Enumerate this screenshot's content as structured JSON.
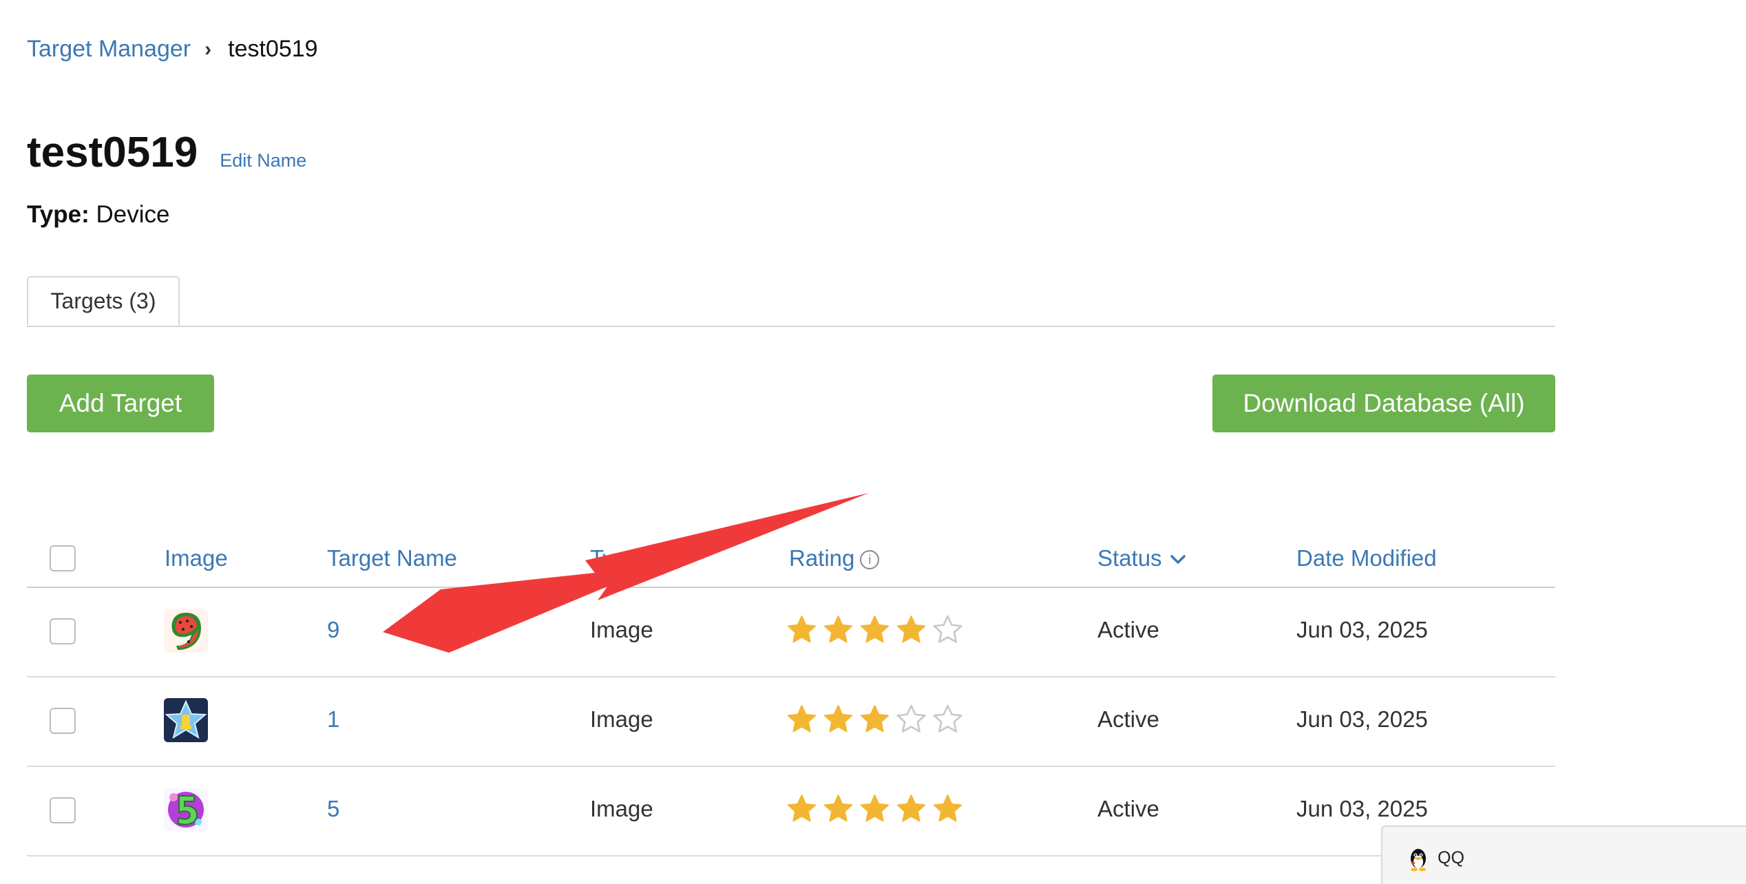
{
  "breadcrumb": {
    "parent": "Target Manager",
    "separator": "›",
    "current": "test0519"
  },
  "header": {
    "title": "test0519",
    "edit_label": "Edit Name",
    "type_label": "Type:",
    "type_value": "Device"
  },
  "tabs": [
    {
      "label": "Targets (3)",
      "active": true
    }
  ],
  "actions": {
    "add_target": "Add Target",
    "download_database": "Download Database (All)"
  },
  "colors": {
    "link": "#3a78b5",
    "button": "#6cb24f",
    "star_filled": "#f3b632",
    "star_empty": "#c8c8c8",
    "arrow": "#f03a3a"
  },
  "table": {
    "columns": {
      "image": "Image",
      "target_name": "Target Name",
      "type": "Type",
      "rating": "Rating",
      "status": "Status",
      "date_modified": "Date Modified"
    },
    "rating_info_icon": "info-icon",
    "status_sort_icon": "chevron-down-icon",
    "rows": [
      {
        "thumbnail": "watermelon-nine-thumbnail",
        "name": "9",
        "type": "Image",
        "rating": 4,
        "rating_max": 5,
        "status": "Active",
        "date_modified": "Jun 03, 2025"
      },
      {
        "thumbnail": "star-one-thumbnail",
        "name": "1",
        "type": "Image",
        "rating": 3,
        "rating_max": 5,
        "status": "Active",
        "date_modified": "Jun 03, 2025"
      },
      {
        "thumbnail": "colorful-five-thumbnail",
        "name": "5",
        "type": "Image",
        "rating": 5,
        "rating_max": 5,
        "status": "Active",
        "date_modified": "Jun 03, 2025"
      }
    ]
  },
  "popup": {
    "icon": "qq-penguin-icon",
    "label": "QQ"
  }
}
